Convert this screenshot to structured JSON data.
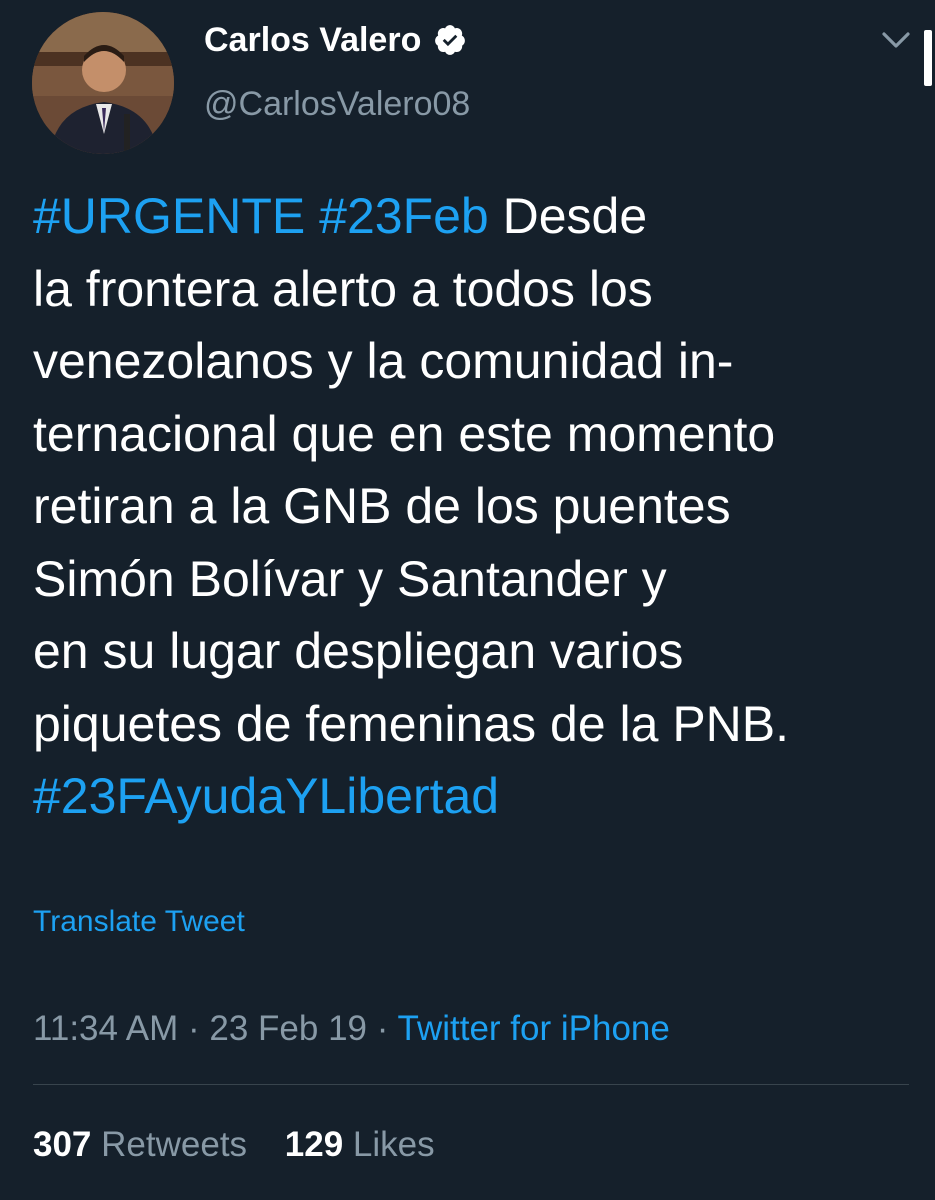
{
  "author": {
    "display_name": "Carlos Valero",
    "handle": "@CarlosValero08",
    "verified": true,
    "verified_icon": "verified-badge-icon"
  },
  "tweet": {
    "lines": [
      [
        {
          "text": "#URGENTE #23Feb",
          "kind": "hashtag"
        },
        {
          "text": " Desde",
          "kind": "text"
        }
      ],
      [
        {
          "text": "la frontera alerto a todos los",
          "kind": "text"
        }
      ],
      [
        {
          "text": "venezolanos y la comunidad in-",
          "kind": "text"
        }
      ],
      [
        {
          "text": "ternacional que en este momento",
          "kind": "text"
        }
      ],
      [
        {
          "text": "retiran a la GNB de los puentes",
          "kind": "text"
        }
      ],
      [
        {
          "text": "Simón Bolívar y Santander y",
          "kind": "text"
        }
      ],
      [
        {
          "text": "en su lugar despliegan varios",
          "kind": "text"
        }
      ],
      [
        {
          "text": "piquetes de femeninas de la PNB.",
          "kind": "text"
        }
      ],
      [
        {
          "text": "#23FAyudaYLibertad",
          "kind": "hashtag"
        }
      ]
    ],
    "translate_label": "Translate Tweet"
  },
  "meta": {
    "time": "11:34 AM",
    "separator": " · ",
    "date": "23 Feb 19",
    "source": "Twitter for iPhone"
  },
  "stats": {
    "retweets_count": "307",
    "retweets_label": "Retweets",
    "likes_count": "129",
    "likes_label": "Likes"
  },
  "colors": {
    "background": "#15202b",
    "accent": "#1da1f2",
    "secondary_text": "#8899a6",
    "divider": "#38444d"
  },
  "icons": {
    "menu": "chevron-down-icon"
  }
}
